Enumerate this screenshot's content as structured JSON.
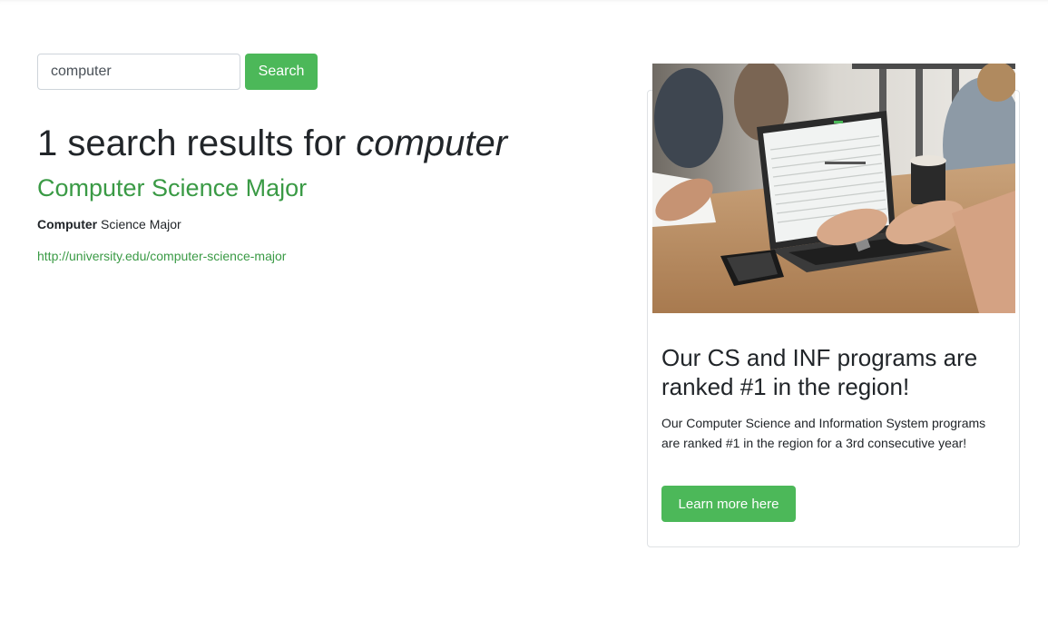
{
  "search": {
    "query": "computer",
    "button_label": "Search"
  },
  "results": {
    "count": "1",
    "heading_prefix": "search results for",
    "heading_term": "computer",
    "items": [
      {
        "title": "Computer Science Major",
        "snippet_bold": "Computer",
        "snippet_rest": " Science Major",
        "url": "http://university.edu/computer-science-major"
      }
    ]
  },
  "promo": {
    "title": "Our CS and INF programs are ranked #1 in the region!",
    "text": "Our Computer Science and Information System programs are ranked #1 in the region for a 3rd consecutive year!",
    "button_label": "Learn more here"
  },
  "colors": {
    "accent_green": "#4cb859",
    "link_green": "#3a9a45",
    "text": "#212529",
    "border": "#dfe2e5"
  }
}
